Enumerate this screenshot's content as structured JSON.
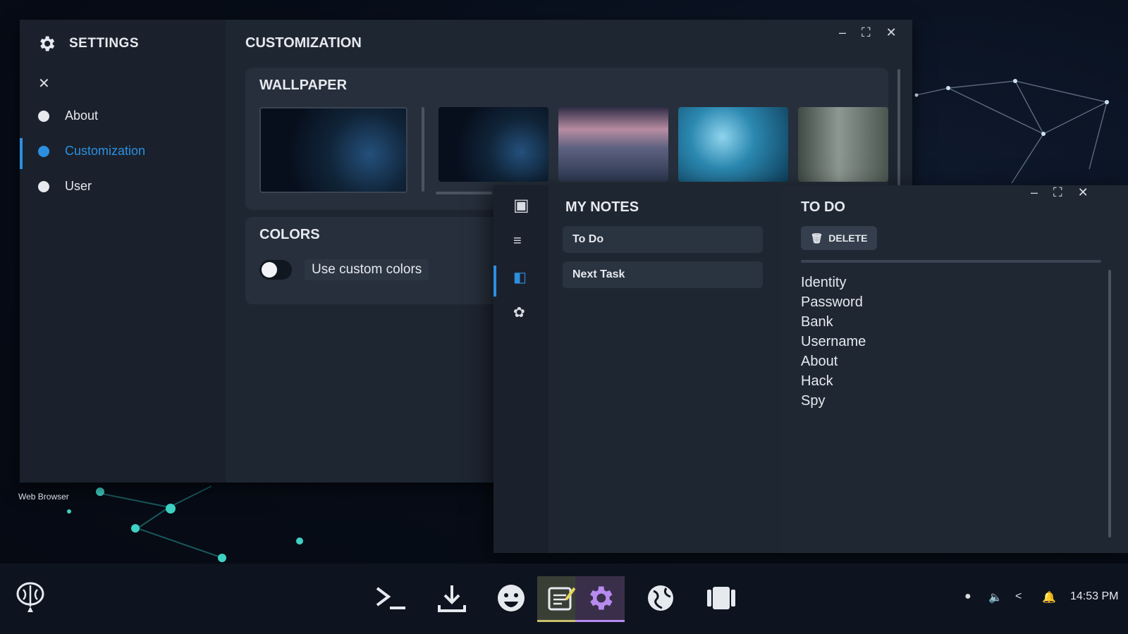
{
  "settings": {
    "title": "SETTINGS",
    "nav": [
      {
        "label": "About"
      },
      {
        "label": "Customization"
      },
      {
        "label": "User"
      }
    ],
    "content_title": "CUSTOMIZATION",
    "wallpaper_title": "WALLPAPER",
    "colors_title": "COLORS",
    "custom_colors_label": "Use custom colors"
  },
  "notes": {
    "list_title": "MY NOTES",
    "items": [
      {
        "label": "To Do"
      },
      {
        "label": "Next Task"
      }
    ],
    "detail_title": "TO DO",
    "delete_label": "DELETE",
    "lines": [
      "Identity",
      "Password",
      "Bank",
      "Username",
      "About",
      "Hack",
      "Spy"
    ]
  },
  "desktop": {
    "icon_label": "Web Browser"
  },
  "taskbar": {
    "clock": "14:53 PM"
  },
  "colors": {
    "accent": "#2d8fe0",
    "window_bg": "#1e2632"
  }
}
